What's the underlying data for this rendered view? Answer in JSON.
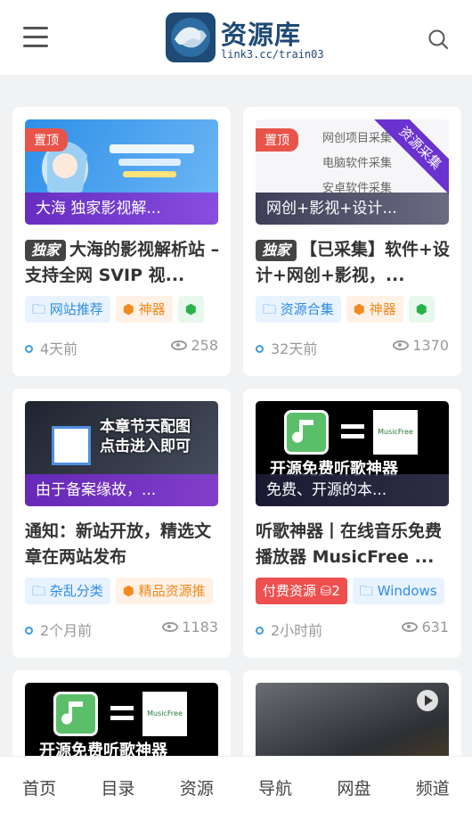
{
  "header": {
    "logo_title": "资源库",
    "logo_sub": "link3.cc/train03"
  },
  "cards": [
    {
      "pin": "置顶",
      "thumb_caption": "大海 独家影视解...",
      "exclusive": "独家",
      "title": "大海的影视解析站 – 支持全网 SVIP 视...",
      "tags": [
        "网站推荐",
        "神器",
        ""
      ],
      "time": "4天前",
      "views": "258"
    },
    {
      "pin": "置顶",
      "thumb_caption": "网创+影视+设计...",
      "corner_banner": "资源采集",
      "thumb_lines": [
        "网创项目采集",
        "电脑软件采集",
        "安卓软件采集"
      ],
      "exclusive": "独家",
      "title": "【已采集】软件+设计+网创+影视，...",
      "tags": [
        "资源合集",
        "神器",
        ""
      ],
      "time": "32天前",
      "views": "1370"
    },
    {
      "thumb_caption": "由于备案缘故，...",
      "thumb_overlay": [
        "本章节天配图",
        "点击进入即可"
      ],
      "title": "通知：新站开放，精选文章在两站发布",
      "tags": [
        "杂乱分类",
        "精品资源推"
      ],
      "time": "2个月前",
      "views": "1183"
    },
    {
      "thumb_caption": "免费、开源的本...",
      "thumb_banner": "开源免费听歌神器",
      "thumb_brand": "MusicFree",
      "title": "听歌神器丨在线音乐免费播放器 MusicFree ...",
      "tags": [
        "付费资源",
        "2",
        "Windows"
      ],
      "time": "2小时前",
      "views": "631"
    },
    {
      "thumb_banner": "开源免费听歌神器",
      "thumb_brand": "MusicFree"
    },
    {}
  ],
  "nav": [
    "首页",
    "目录",
    "资源",
    "导航",
    "网盘",
    "频道"
  ],
  "colors": {
    "brand": "#1e4a75",
    "accent_purple": "#7a3ad6",
    "pin_red": "#e8544a"
  }
}
